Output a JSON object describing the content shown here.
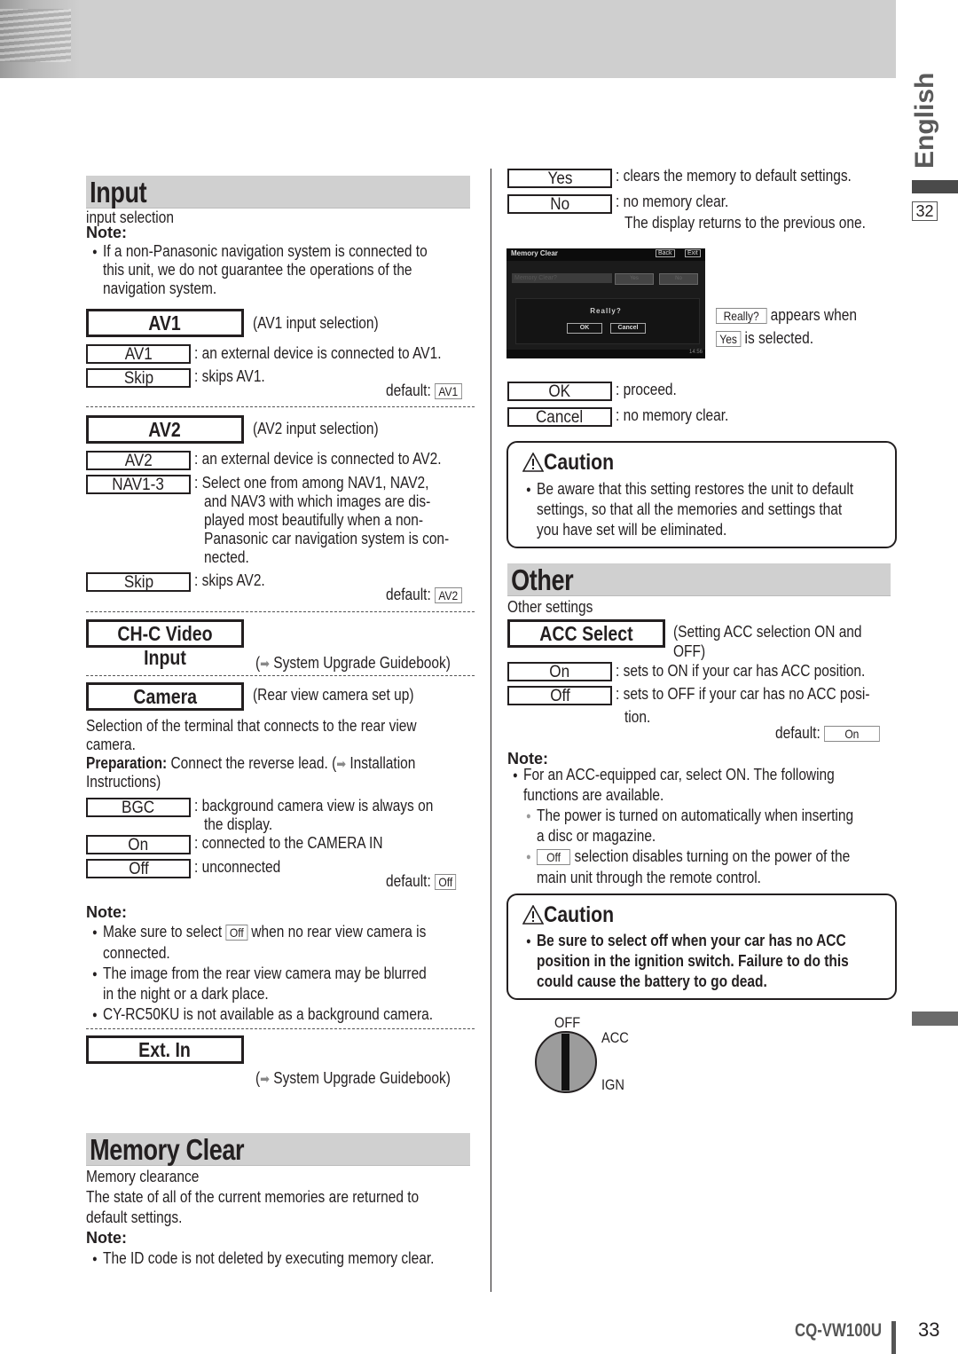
{
  "sidebar": {
    "language": "English",
    "page_box": "32"
  },
  "footer": {
    "model": "CQ-VW100U",
    "page_number": "33"
  },
  "input": {
    "title": "Input",
    "subtitle": "input selection",
    "note_label": "Note:",
    "note_lines": [
      "If a non-Panasonic navigation system is connected to",
      "this unit, we do not guarantee the operations of the",
      "navigation system."
    ],
    "av1": {
      "label": "AV1",
      "desc": "(AV1 input selection)",
      "options": [
        {
          "label": "AV1",
          "desc": ": an external device is connected to AV1."
        },
        {
          "label": "Skip",
          "desc": ": skips AV1."
        }
      ],
      "default_label": "default:",
      "default_value": "AV1"
    },
    "av2": {
      "label": "AV2",
      "desc": "(AV2 input selection)",
      "options": [
        {
          "label": "AV2",
          "desc": ": an external device is connected to AV2."
        },
        {
          "label": "NAV1-3",
          "desc_lines": [
            ": Select one from among NAV1, NAV2,",
            "and NAV3 with which images are dis-",
            "played most beautifully when a non-",
            "Panasonic car navigation system is con-",
            "nected."
          ]
        },
        {
          "label": "Skip",
          "desc": ": skips AV2."
        }
      ],
      "default_label": "default:",
      "default_value": "AV2"
    },
    "chc": {
      "label": "CH-C Video Input",
      "ref": "System Upgrade Guidebook)",
      "ref_open": "("
    },
    "camera": {
      "label": "Camera",
      "desc": "(Rear view camera set up)",
      "intro_lines": [
        "Selection of the terminal that connects to the rear view",
        "camera."
      ],
      "prep_label": "Preparation:",
      "prep_text": "Connect the reverse lead. (",
      "prep_ref": "Installation",
      "prep_ref2": "Instructions)",
      "options": [
        {
          "label": "BGC",
          "desc_lines": [
            ": background camera view is always on",
            "the display."
          ]
        },
        {
          "label": "On",
          "desc": ": connected to the CAMERA IN"
        },
        {
          "label": "Off",
          "desc": ": unconnected"
        }
      ],
      "default_label": "default:",
      "default_value": "Off",
      "note_label": "Note:",
      "notes": [
        {
          "pre": "Make sure to select",
          "box": "Off",
          "post": "when no rear view camera is",
          "cont": "connected."
        },
        {
          "line1": "The image from the rear view camera may be blurred",
          "line2": "in the night or a dark place."
        },
        {
          "line1": "CY-RC50KU is not available as a background camera."
        }
      ]
    },
    "extin": {
      "label": "Ext. In",
      "ref": "System Upgrade Guidebook)",
      "ref_open": "("
    }
  },
  "memory_clear": {
    "title": "Memory Clear",
    "subtitle": "Memory clearance",
    "desc_lines": [
      "The state of all of the current memories are returned to",
      "default settings."
    ],
    "note_label": "Note:",
    "note": "The ID code is not deleted by executing memory clear.",
    "options": [
      {
        "label": "Yes",
        "desc": ": clears the memory to default settings."
      },
      {
        "label": "No",
        "desc": ": no memory clear.",
        "desc2": "The display returns to the previous one."
      }
    ],
    "screen": {
      "title": "Memory Clear",
      "back": "Back",
      "exit": "Exit",
      "prompt": "Memory Clear?",
      "yes": "Yes",
      "no": "No",
      "really": "Really?",
      "ok": "OK",
      "cancel": "Cancel",
      "clock": "14:56"
    },
    "really_box": "Really?",
    "really_text": "appears when",
    "yes_box": "Yes",
    "yes_text": "is selected.",
    "confirm_options": [
      {
        "label": "OK",
        "desc": ": proceed."
      },
      {
        "label": "Cancel",
        "desc": ": no memory clear."
      }
    ],
    "caution": {
      "title": "Caution",
      "lines": [
        "Be aware that this setting restores the unit to default",
        "settings, so that all the memories and settings that",
        "you have set will be eliminated."
      ]
    }
  },
  "other": {
    "title": "Other",
    "subtitle": "Other settings",
    "acc": {
      "label": "ACC Select",
      "desc_lines": [
        "(Setting ACC selection ON and",
        "OFF)"
      ],
      "options": [
        {
          "label": "On",
          "desc": ": sets to ON if your car has ACC position."
        },
        {
          "label": "Off",
          "desc": ": sets to OFF if your car has no ACC posi-",
          "desc2": "tion."
        }
      ],
      "default_label": "default:",
      "default_value": "On"
    },
    "note_label": "Note:",
    "note_lines": [
      "For an ACC-equipped car, select ON.  The following",
      "functions are available."
    ],
    "sub_notes": [
      {
        "line1": "The power is turned on automatically when inserting",
        "line2": "a disc or magazine."
      },
      {
        "box": "Off",
        "line1": "selection disables turning on the power of the",
        "line2": "main unit through the remote control."
      }
    ],
    "caution": {
      "title": "Caution",
      "lines": [
        "Be sure to select off when your car has no ACC",
        "position in the ignition switch. Failure to do this",
        "could cause the battery to go dead."
      ]
    },
    "ignition": {
      "off": "OFF",
      "acc": "ACC",
      "ign": "IGN"
    }
  }
}
